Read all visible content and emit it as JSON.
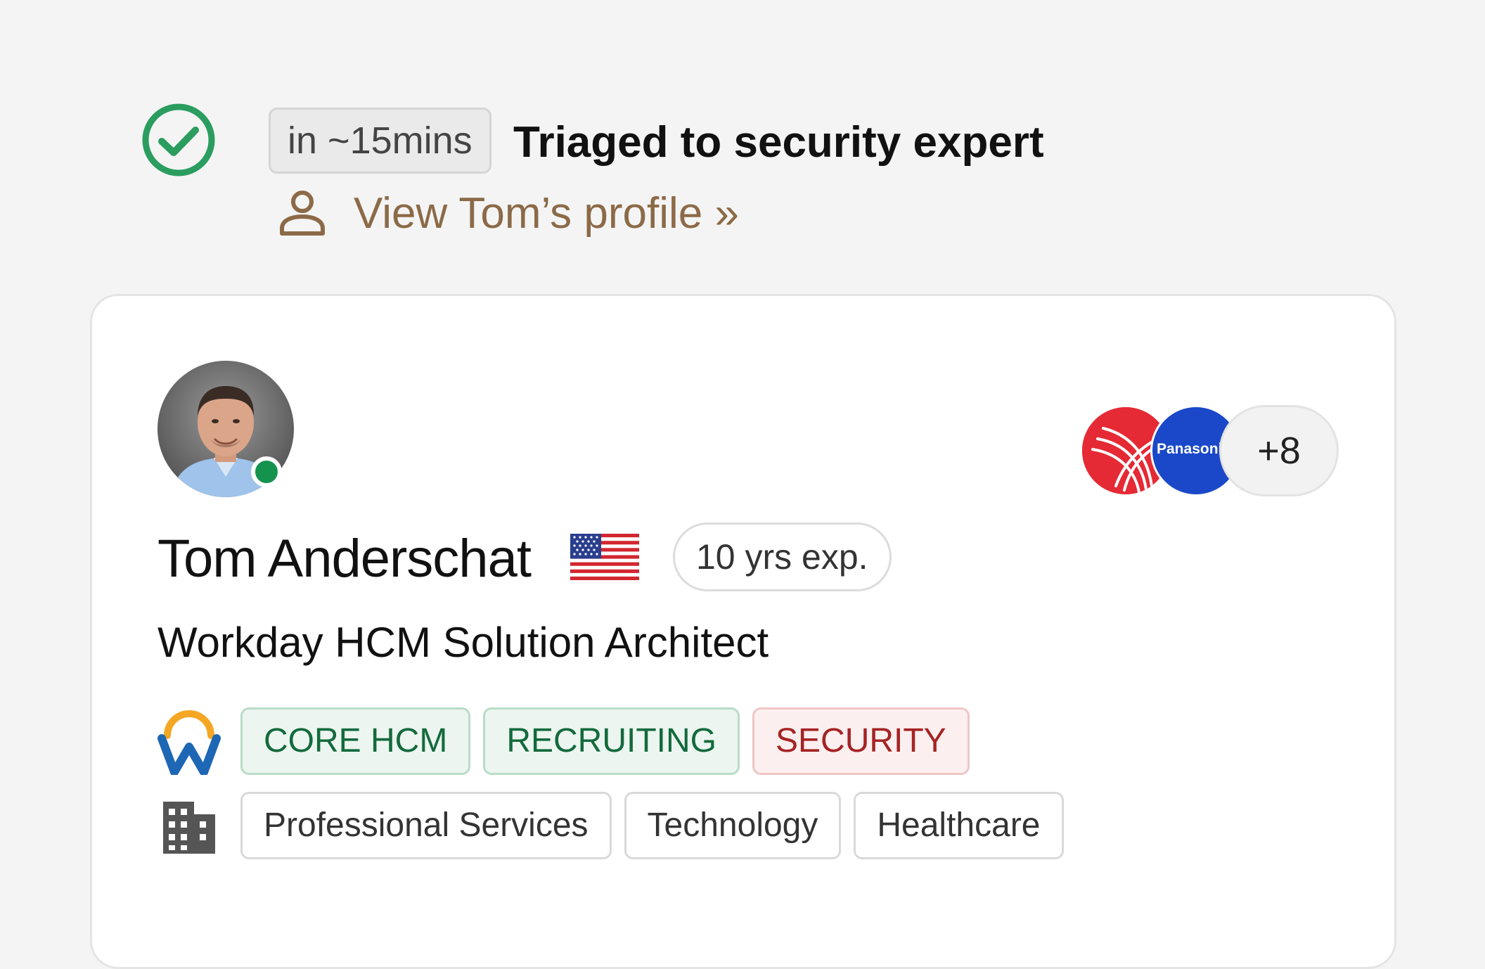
{
  "status": {
    "time_badge": "in ~15mins",
    "title": "Triaged to security expert",
    "profile_link": "View Tom’s profile »"
  },
  "expert": {
    "name": "Tom Anderschat",
    "experience": "10 yrs exp.",
    "role": "Workday HCM Solution Architect",
    "online": true,
    "country_flag": "us-flag-icon"
  },
  "companies": {
    "logos": [
      "red-arcs-logo",
      "Panasonic"
    ],
    "more_count": "+8"
  },
  "skills": {
    "platform_icon": "workday-logo-icon",
    "tags": [
      {
        "label": "CORE HCM",
        "variant": "green"
      },
      {
        "label": "RECRUITING",
        "variant": "green"
      },
      {
        "label": "SECURITY",
        "variant": "red"
      }
    ]
  },
  "industries": {
    "icon": "building-icon",
    "tags": [
      "Professional Services",
      "Technology",
      "Healthcare"
    ]
  },
  "colors": {
    "success": "#2a9d5f",
    "link": "#8c6a47",
    "online": "#16924f",
    "skill_green": "#136a3c",
    "skill_red": "#a52323"
  }
}
